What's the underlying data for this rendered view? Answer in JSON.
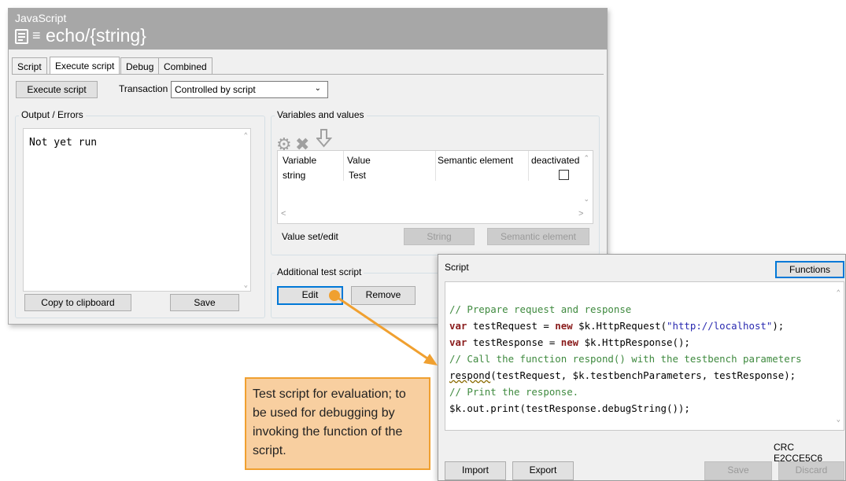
{
  "window": {
    "language": "JavaScript",
    "title": "echo/{string}",
    "menu_glyph": "≡",
    "tabs": [
      {
        "label": "Script",
        "active": false
      },
      {
        "label": "Execute script",
        "active": true
      },
      {
        "label": "Debug",
        "active": false
      },
      {
        "label": "Combined",
        "active": false
      }
    ]
  },
  "toolbar": {
    "execute_label": "Execute script",
    "transaction_label": "Transaction",
    "transaction_value": "Controlled by script"
  },
  "output": {
    "group_label": "Output / Errors",
    "text": "Not yet run",
    "copy_label": "Copy to clipboard",
    "save_label": "Save"
  },
  "variables": {
    "group_label": "Variables and values",
    "icons": [
      "gear-icon",
      "delete-x-icon",
      "import-arrow-icon"
    ],
    "columns": [
      "Variable",
      "Value",
      "Semantic element",
      "deactivated"
    ],
    "rows": [
      {
        "variable": "string",
        "value": "Test",
        "semantic": "",
        "deactivated": false
      }
    ],
    "value_set_label": "Value set/edit",
    "string_button": "String",
    "semantic_button": "Semantic element"
  },
  "additional": {
    "group_label": "Additional test script",
    "edit_label": "Edit",
    "remove_label": "Remove"
  },
  "script_panel": {
    "title": "Script",
    "functions_label": "Functions",
    "crc": "CRC E2CCE5C6",
    "import_label": "Import",
    "export_label": "Export",
    "save_label": "Save",
    "discard_label": "Discard",
    "code_lines": [
      "// Prepare request and response",
      "var testRequest = new $k.HttpRequest(\"http://localhost\");",
      "var testResponse = new $k.HttpResponse();",
      "// Call the function respond() with the testbench parameters",
      "respond(testRequest, $k.testbenchParameters, testResponse);",
      "// Print the response.",
      "$k.out.print(testResponse.debugString());"
    ]
  },
  "callout": {
    "text": "Test script for evaluation; to be used for debugging by invoking the function of the script."
  },
  "colors": {
    "titlebar": "#a7a7a7",
    "callout_fill": "#f8cfa0",
    "callout_border": "#f0a030",
    "arrow": "#f0a030",
    "focus": "#0078d7",
    "comment": "#3f8a3f",
    "keyword": "#8a1c1c"
  }
}
